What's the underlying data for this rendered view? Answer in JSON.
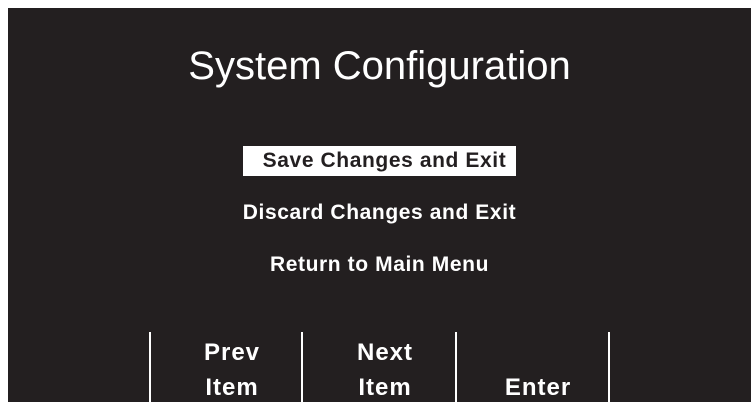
{
  "title": "System Configuration",
  "menu": {
    "items": [
      {
        "label": "Save Changes and Exit",
        "selected": true
      },
      {
        "label": "Discard Changes and Exit",
        "selected": false
      },
      {
        "label": "Return to Main Menu",
        "selected": false
      }
    ]
  },
  "softkeys": [
    {
      "line1": "Prev",
      "line2": "Item"
    },
    {
      "line1": "Next",
      "line2": "Item"
    },
    {
      "line1": "",
      "line2": "Enter"
    },
    {
      "line1": "",
      "line2": ""
    }
  ],
  "colors": {
    "background": "#231f20",
    "foreground": "#ffffff",
    "selection": "#ffffff"
  }
}
